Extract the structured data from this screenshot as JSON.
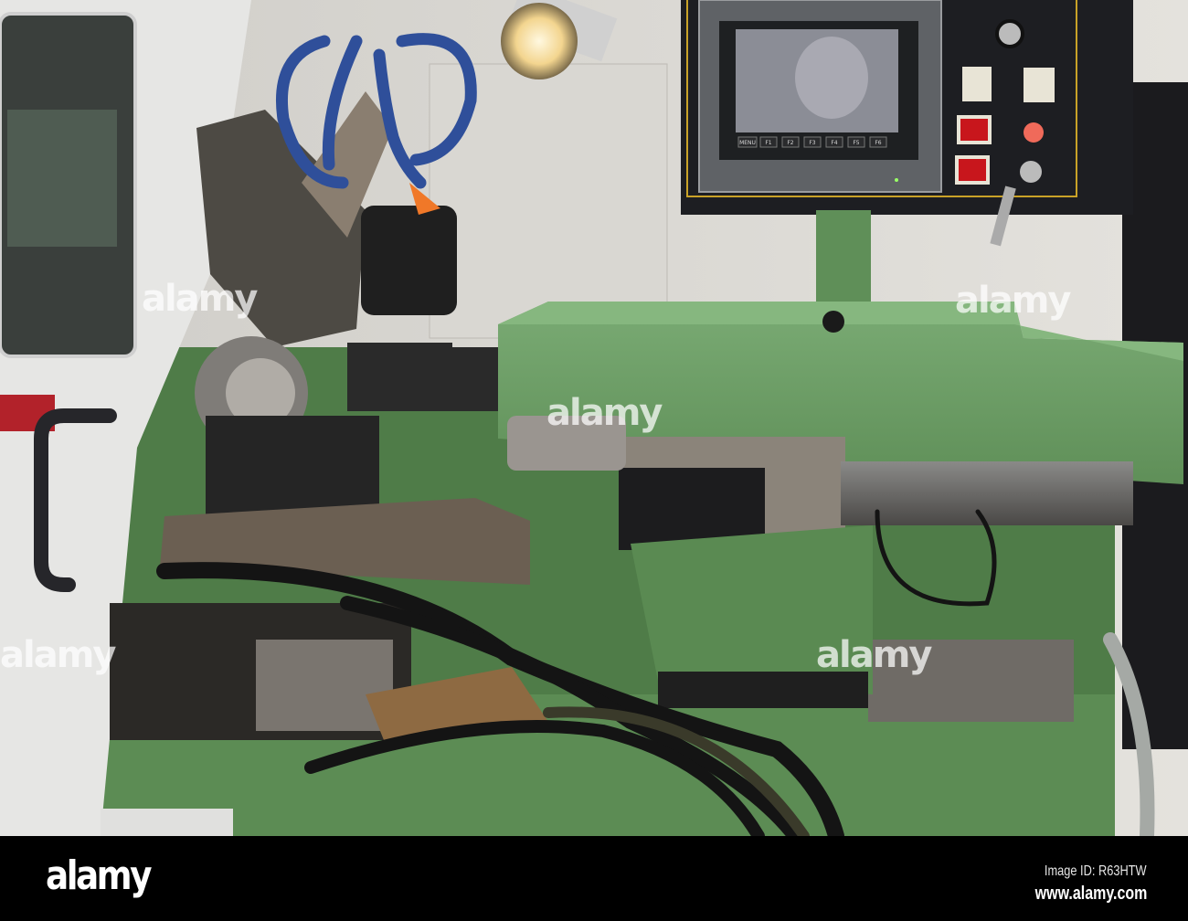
{
  "watermark": "alamy",
  "control_panel": {
    "function_keys": [
      "MENU",
      "F1",
      "F2",
      "F3",
      "F4",
      "F5",
      "F6"
    ]
  },
  "footer": {
    "logo": "alamy",
    "image_id": "Image ID: R63HTW",
    "url": "www.alamy.com"
  },
  "colors": {
    "machine_green": "#6a9a63",
    "panel_dark": "#1d1e22",
    "coolant_blue": "#2f4f9a",
    "switch_red": "#c8161c"
  }
}
